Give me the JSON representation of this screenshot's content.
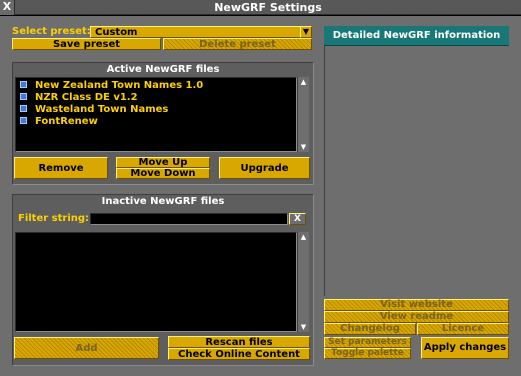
{
  "window": {
    "title": "NewGRF Settings",
    "close_glyph": "X"
  },
  "preset": {
    "label": "Select preset:",
    "value": "Custom",
    "save_label": "Save preset",
    "delete_label": "Delete preset"
  },
  "active": {
    "title": "Active NewGRF files",
    "items": [
      {
        "label": "New Zealand Town Names 1.0"
      },
      {
        "label": "NZR Class DE v1.2"
      },
      {
        "label": "Wasteland Town Names"
      },
      {
        "label": "FontRenew"
      }
    ],
    "remove_label": "Remove",
    "move_up_label": "Move Up",
    "move_down_label": "Move Down",
    "upgrade_label": "Upgrade"
  },
  "inactive": {
    "title": "Inactive NewGRF files",
    "filter_label": "Filter string:",
    "filter_value": "",
    "clear_glyph": "X",
    "add_label": "Add",
    "rescan_label": "Rescan files",
    "check_online_label": "Check Online Content"
  },
  "info": {
    "title": "Detailed NewGRF information",
    "visit_website_label": "Visit website",
    "view_readme_label": "View readme",
    "changelog_label": "Changelog",
    "licence_label": "Licence",
    "set_parameters_label": "Set parameters",
    "toggle_palette_label": "Toggle palette",
    "apply_label": "Apply changes"
  },
  "colors": {
    "button": "#d8a800",
    "label_yellow": "#fdd000",
    "info_header": "#187878",
    "window": "#6e6e6e"
  },
  "icons": {
    "close": "close-icon",
    "grf": "grf-file-icon",
    "dropdown": "dropdown-arrow-icon",
    "scroll_up": "scroll-up-icon",
    "scroll_down": "scroll-down-icon"
  }
}
